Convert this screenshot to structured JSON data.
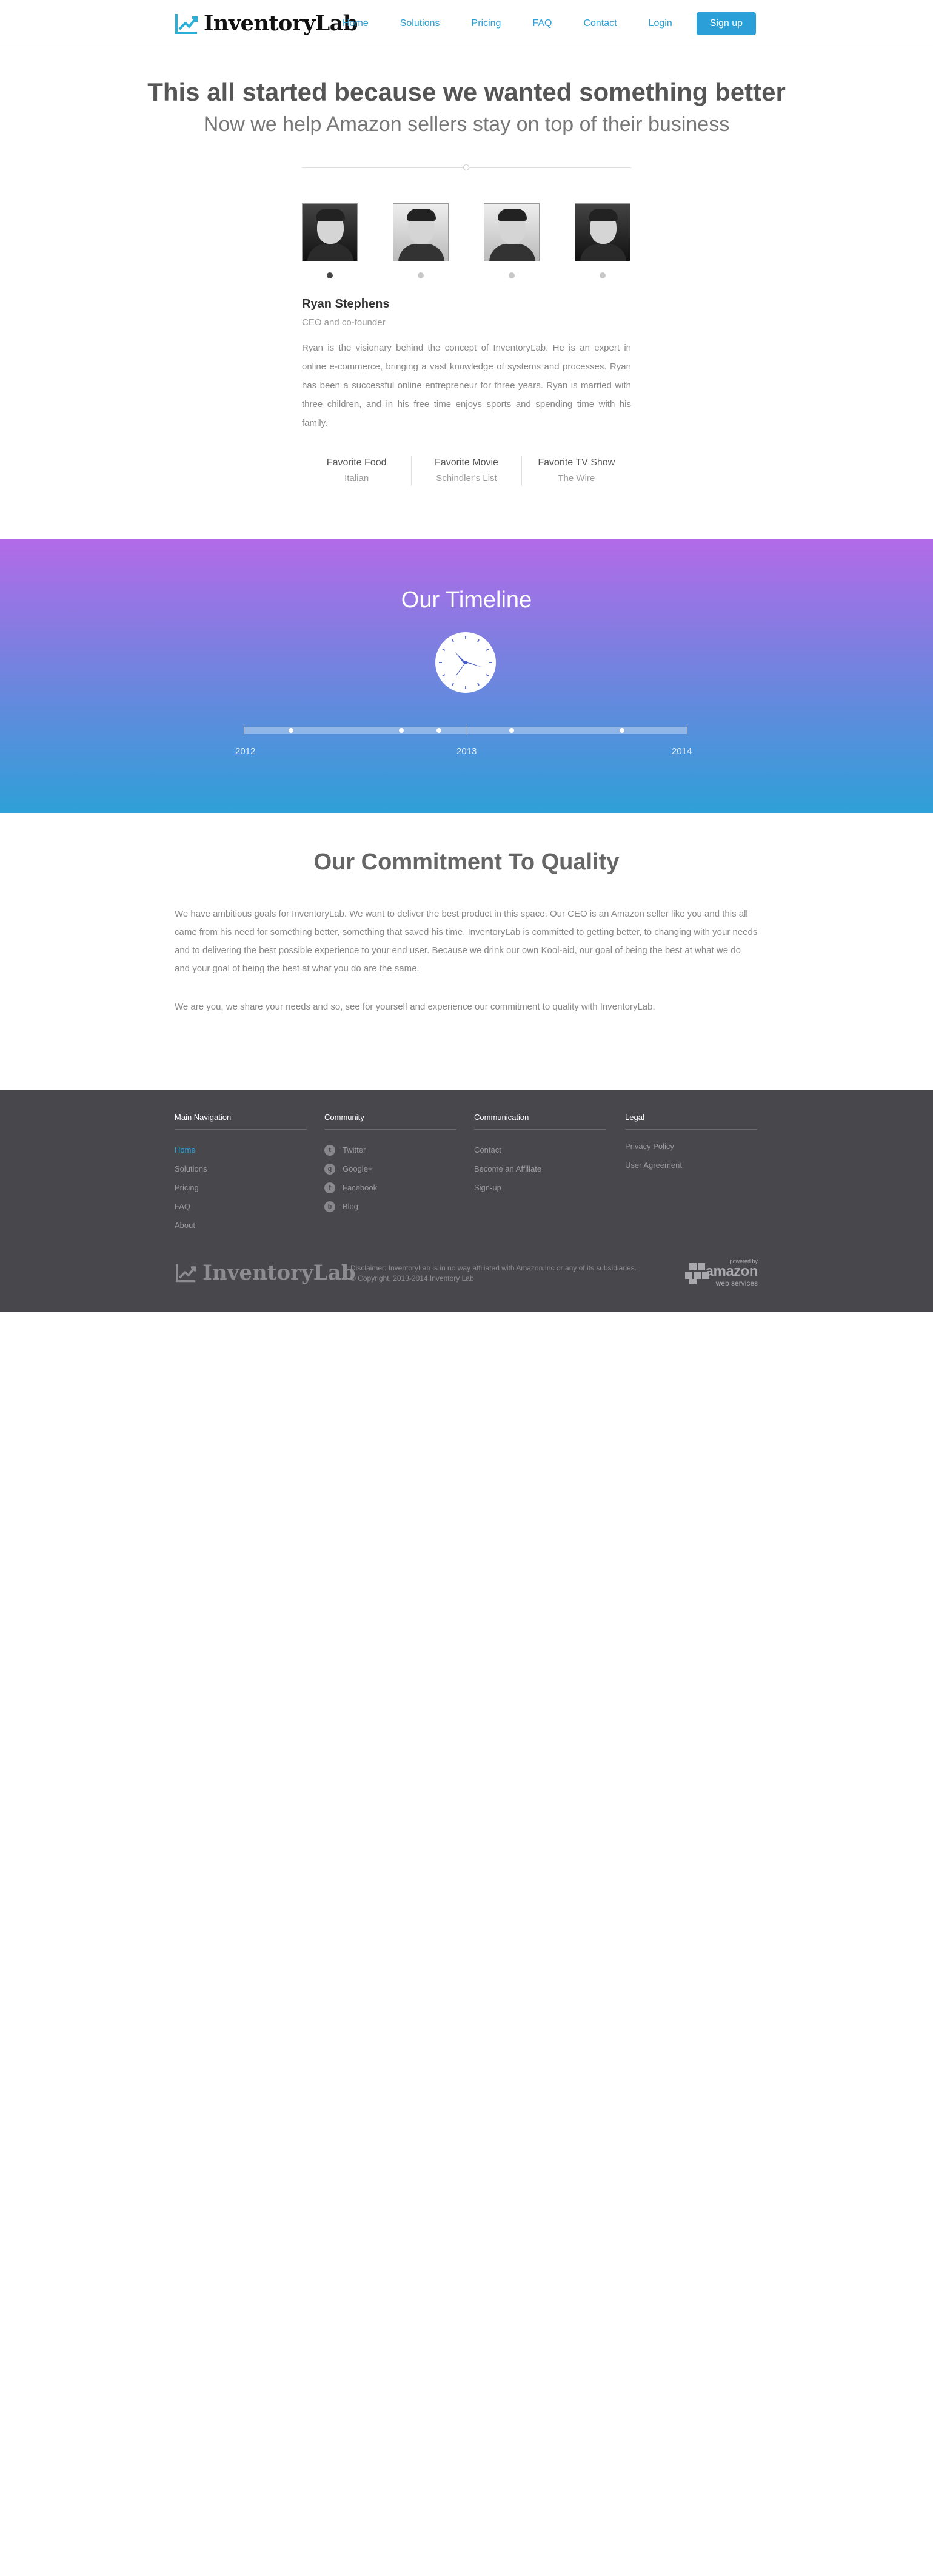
{
  "header": {
    "brand": "InventoryLab",
    "nav": [
      "Home",
      "Solutions",
      "Pricing",
      "FAQ",
      "Contact",
      "Login"
    ],
    "signup": "Sign up",
    "accent": "#2a9fd8"
  },
  "hero": {
    "title": "This all started because we wanted something better",
    "subtitle": "Now we help Amazon sellers stay on top of their business"
  },
  "team": {
    "selected_index": 0,
    "person": {
      "name": "Ryan Stephens",
      "title": "CEO and co-founder",
      "bio": "Ryan is the visionary behind the concept of InventoryLab. He is an expert in online e-commerce, bringing a vast knowledge of systems and processes. Ryan has been a successful online entrepreneur for three years. Ryan is married with three children, and in his free time enjoys sports and spending time with his family."
    },
    "favorites": [
      {
        "label": "Favorite Food",
        "value": "Italian"
      },
      {
        "label": "Favorite Movie",
        "value": "Schindler's List"
      },
      {
        "label": "Favorite TV Show",
        "value": "The Wire"
      }
    ]
  },
  "timeline": {
    "title": "Our Timeline",
    "years": [
      "2012",
      "2013",
      "2014"
    ],
    "clock_icon": "clock-icon"
  },
  "commitment": {
    "title": "Our Commitment To Quality",
    "paragraphs": [
      "We have ambitious goals for InventoryLab. We want to deliver the best product in this space. Our CEO is an Amazon seller like you and this all came from his need for something better, something that saved his time. InventoryLab is committed to getting better, to changing with your needs and to delivering the best possible experience to your end user. Because we drink our own Kool-aid, our goal of being the best at what we do and your goal of being the best at what you do are the same.",
      "We are you, we share your needs and so, see for yourself and experience our commitment to quality with InventoryLab."
    ]
  },
  "footer": {
    "columns": [
      {
        "heading": "Main Navigation",
        "items": [
          "Home",
          "Solutions",
          "Pricing",
          "FAQ",
          "About"
        ]
      },
      {
        "heading": "Community",
        "items": [
          "Twitter",
          "Google+",
          "Facebook",
          "Blog"
        ]
      },
      {
        "heading": "Communication",
        "items": [
          "Contact",
          "Become an Affiliate",
          "Sign-up"
        ]
      },
      {
        "heading": "Legal",
        "items": [
          "Privacy Policy",
          "User Agreement"
        ]
      }
    ],
    "community_icons": [
      "twitter-icon",
      "google-plus-icon",
      "facebook-icon",
      "blog-icon"
    ],
    "brand": "InventoryLab",
    "disclaimer": "Disclaimer: InventoryLab is in no way affiliated with Amazon.Inc or any of its subsidiaries.",
    "copyright": "© Copyright, 2013-2014 Inventory Lab",
    "aws": {
      "small": "powered by",
      "big": "amazon",
      "sub": "web services"
    }
  }
}
